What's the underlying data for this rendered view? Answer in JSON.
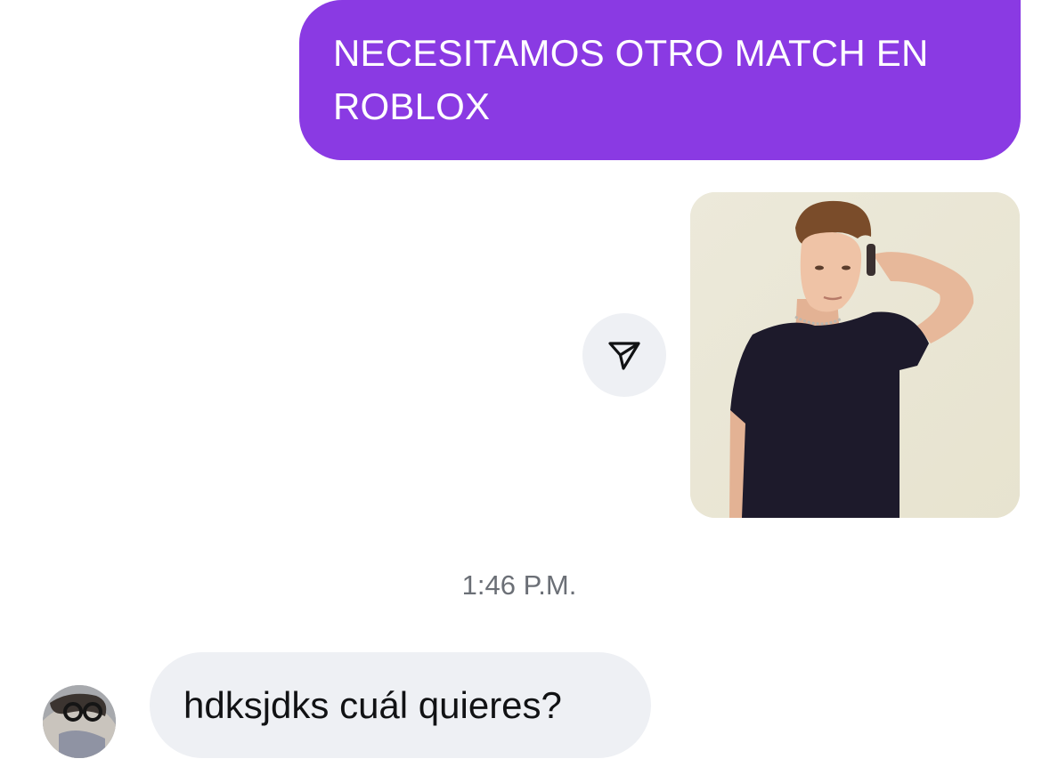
{
  "messages": {
    "outgoing_text": "NECESITAMOS OTRO MATCH EN ROBLOX",
    "incoming_text": "hdksjdks cuál quieres?"
  },
  "shared_media": {
    "type": "photo",
    "share_icon": "send-icon"
  },
  "timestamp": "1:46 P.M.",
  "colors": {
    "outgoing_bubble": "#8a3ae3",
    "incoming_bubble": "#eef0f4",
    "share_button_bg": "#eef0f4",
    "timestamp_text": "#6b6f76"
  }
}
